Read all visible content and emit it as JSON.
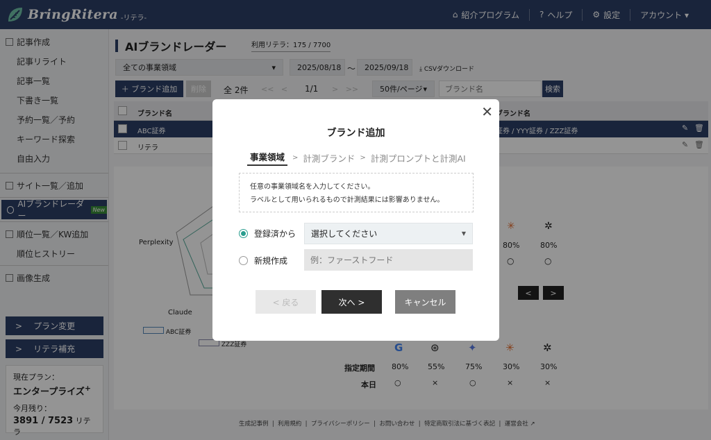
{
  "header": {
    "logo_text": "BringRitera",
    "logo_sub": "-リテラ-",
    "nav": [
      {
        "label": "紹介プログラム",
        "icon": "referral-icon"
      },
      {
        "label": "ヘルプ",
        "icon": "help-icon"
      },
      {
        "label": "設定",
        "icon": "gear-icon"
      },
      {
        "label": "アカウント ▾",
        "icon": ""
      }
    ]
  },
  "sidebar": {
    "group1": [
      "記事作成",
      "記事リライト",
      "記事一覧",
      "下書き一覧",
      "予約一覧／予約",
      "キーワード探索",
      "自由入力"
    ],
    "group2": [
      "サイト一覧／追加"
    ],
    "active": "AIブランドレーダー",
    "new_badge": "New",
    "group3": [
      "順位一覧／KW追加",
      "順位ヒストリー"
    ],
    "group4": [
      "画像生成"
    ],
    "plan_change": "プラン変更",
    "ritera_add": "リテラ補充",
    "plan_label": "現在プラン：",
    "plan_name": "エンタープライズ",
    "plan_plus": "+",
    "remain_label": "今月残り：",
    "remain_value": "3891 / 7523",
    "remain_unit": "リテラ"
  },
  "main": {
    "title": "AIブランドレーダー",
    "usage": "利用リテラ：175 / 7700",
    "domain_select": "全ての事業領域",
    "date_from": "2025/08/18",
    "date_sep": "〜",
    "date_to": "2025/09/18",
    "csv": "CSVダウンロード",
    "add_brand": "＋ ブランド追加",
    "delete": "削除",
    "total": "全 2件",
    "page": "1/1",
    "per_page": "50件/ページ",
    "search_placeholder": "ブランド名",
    "search_btn": "検索",
    "col_brand": "ブランド名",
    "col_brand2": "ブランド名",
    "rows": [
      {
        "name": "ABC証券",
        "right": "証券 / YYY証券 / ZZZ証券"
      },
      {
        "name": "リテラ",
        "right": ""
      }
    ],
    "radar_labels": [
      "Perplexity",
      "Claude"
    ],
    "legend": [
      "ABC証券",
      "ZZZ証券"
    ],
    "chart1_values": [
      "80%",
      "80%"
    ],
    "chart2_values": [
      "80%",
      "55%",
      "75%",
      "30%",
      "30%"
    ],
    "row_label_period": "指定期間",
    "row_label_today": "本日",
    "today_marks": [
      "○",
      "×",
      "○",
      "×",
      "×"
    ],
    "footer_links": [
      "生成記事例",
      "利用規約",
      "プライバシーポリシー",
      "お問い合わせ",
      "特定商取引法に基づく表記",
      "運営会社"
    ]
  },
  "modal": {
    "title": "ブランド追加",
    "steps": [
      "事業領域",
      "計測ブランド",
      "計測プロンプトと計測AI"
    ],
    "info_line1": "任意の事業領域名を入力してください。",
    "info_line2": "ラベルとして用いられるもので計測結果には影響ありません。",
    "option_registered": "登録済から",
    "select_placeholder": "選択してください",
    "option_new": "新規作成",
    "new_placeholder": "例：ファーストフード",
    "back": "< 戻る",
    "next": "次へ >",
    "cancel": "キャンセル"
  }
}
